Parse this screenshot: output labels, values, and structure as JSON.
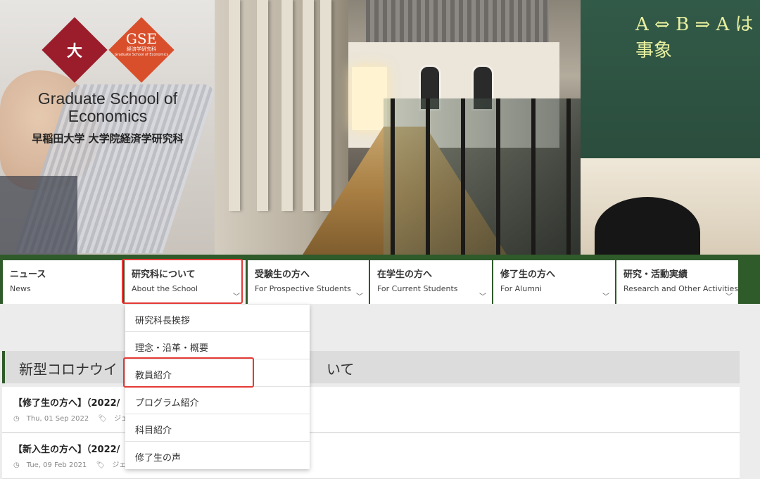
{
  "hero": {
    "school_name_en": "Graduate School of Economics",
    "school_name_jp": "早稲田大学 大学院経済学研究科",
    "logo_badge_text": "GSE",
    "logo_badge_sub": "経済学研究科",
    "logo_badge_sub2": "Graduate School of Economics",
    "logo_seal_text": "大",
    "chalk_text": "A ⇔ B ⇒ A は 事象"
  },
  "nav": {
    "items": [
      {
        "jp": "ニュース",
        "en": "News"
      },
      {
        "jp": "研究科について",
        "en": "About the School"
      },
      {
        "jp": "受験生の方へ",
        "en": "For Prospective Students"
      },
      {
        "jp": "在学生の方へ",
        "en": "For Current Students"
      },
      {
        "jp": "修了生の方へ",
        "en": "For Alumni"
      },
      {
        "jp": "研究・活動実績",
        "en": "Research and Other Activities"
      }
    ],
    "chevron": "﹀"
  },
  "dropdown": {
    "items": [
      "研究科長挨拶",
      "理念・沿革・概要",
      "教員紹介",
      "プログラム紹介",
      "科目紹介",
      "修了生の声"
    ]
  },
  "banner": {
    "text_start": "新型コロナウイ",
    "text_end": "いて"
  },
  "news": [
    {
      "title": "【修了生の方へ】（2022/",
      "date": "Thu, 01 Sep 2022",
      "tag": "ジェネラ"
    },
    {
      "title": "【新入生の方へ】（2022/",
      "date": "Tue, 09 Feb 2021",
      "tag": "ジェネラ"
    }
  ],
  "icons": {
    "clock": "◷",
    "tag": "🏷"
  },
  "colors": {
    "nav_green": "#2f5a2a",
    "highlight_red": "#e53935",
    "brand_crimson": "#9b1c2a",
    "brand_orange": "#d94f2b"
  }
}
